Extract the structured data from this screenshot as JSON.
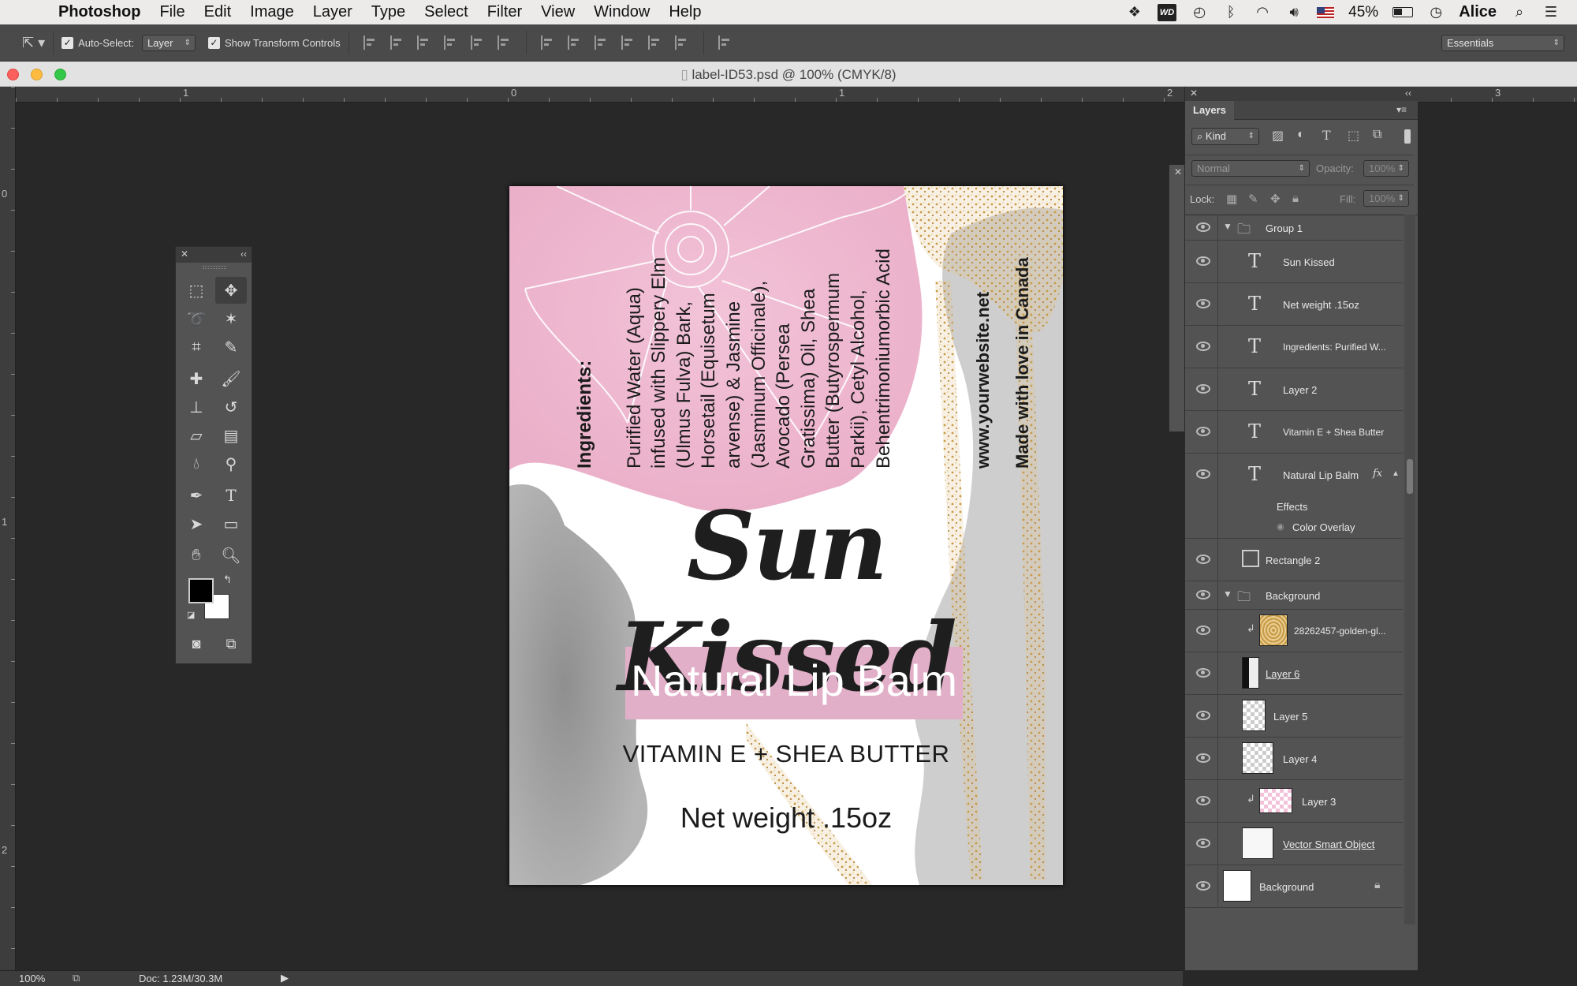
{
  "menubar": {
    "app_name": "Photoshop",
    "items": [
      "File",
      "Edit",
      "Image",
      "Layer",
      "Type",
      "Select",
      "Filter",
      "View",
      "Window",
      "Help"
    ],
    "status": {
      "wd_label": "WD",
      "battery": "45%",
      "user": "Alice"
    }
  },
  "options": {
    "auto_select_label": "Auto-Select:",
    "auto_select_value": "Layer",
    "show_transform_label": "Show Transform Controls",
    "workspace": "Essentials"
  },
  "document": {
    "title": "label-ID53.psd @ 100% (CMYK/8)",
    "ruler_h": [
      "1",
      "0",
      "1",
      "2",
      "3"
    ],
    "ruler_v": [
      "0",
      "1",
      "2"
    ]
  },
  "label": {
    "ingredients_heading": "Ingredients:",
    "ingredients_lines": [
      "Purified Water (Aqua)",
      "infused with Slippery Elm",
      "(Ulmus Fulva) Bark,",
      "Horsetail (Equisetum",
      "arvense) &  Jasmine",
      "(Jasminum Officinale),",
      "Avocado (Persea",
      "Gratissima) Oil, Shea",
      "Butter (Butyrospermum",
      "Parkii), Cetyl Alcohol,",
      "Behentrimoniumorbic Acid"
    ],
    "website": "www.yourwebsite.net",
    "made_with": "Made with love in Canada",
    "title": "Sun Kissed",
    "subtitle": "Natural Lip Balm",
    "vitamin": "VITAMIN E + SHEA BUTTER",
    "net_weight": "Net weight .15oz"
  },
  "layers_panel": {
    "tab": "Layers",
    "kind": "Kind",
    "blend_mode": "Normal",
    "opacity_label": "Opacity:",
    "opacity_value": "100%",
    "lock_label": "Lock:",
    "fill_label": "Fill:",
    "fill_value": "100%",
    "layers": [
      {
        "name": "Group 1",
        "type": "group"
      },
      {
        "name": "Sun Kissed",
        "type": "text"
      },
      {
        "name": "Net weight .15oz",
        "type": "text"
      },
      {
        "name": "Ingredients:   Purified W...",
        "type": "text"
      },
      {
        "name": "Layer 2",
        "type": "text"
      },
      {
        "name": "Vitamin E + Shea Butter",
        "type": "text"
      },
      {
        "name": "Natural Lip Balm",
        "type": "text",
        "fx": "fx"
      },
      {
        "name": "Effects",
        "type": "effects"
      },
      {
        "name": "Color Overlay",
        "type": "effect"
      },
      {
        "name": "Rectangle 2",
        "type": "shape"
      },
      {
        "name": "Background",
        "type": "group"
      },
      {
        "name": "28262457-golden-gl...",
        "type": "image"
      },
      {
        "name": "Layer 6",
        "type": "pixel"
      },
      {
        "name": "Layer 5",
        "type": "pixel"
      },
      {
        "name": "Layer 4",
        "type": "pixel"
      },
      {
        "name": "Layer 3",
        "type": "pixel"
      },
      {
        "name": "Vector Smart Object",
        "type": "smart"
      },
      {
        "name": "Background",
        "type": "background"
      }
    ]
  },
  "statusbar": {
    "zoom": "100%",
    "doc": "Doc: 1.23M/30.3M"
  }
}
